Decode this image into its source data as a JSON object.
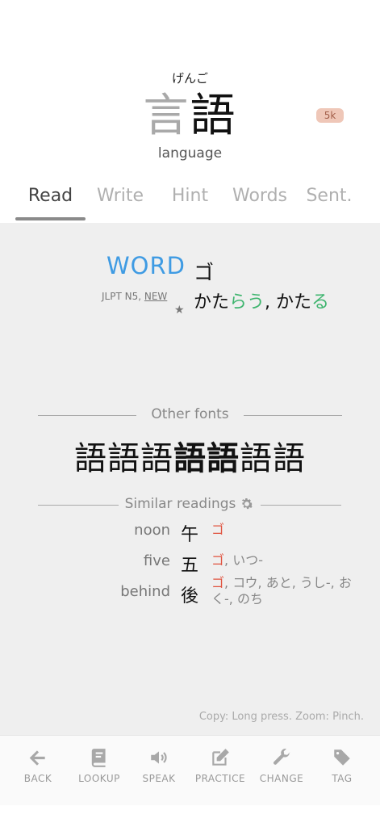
{
  "header": {
    "furigana": "げんご",
    "kanji_first": "言",
    "kanji_second": "語",
    "frequency_badge": "5k",
    "meaning": "language"
  },
  "tabs": [
    {
      "label": "Read",
      "active": true
    },
    {
      "label": "Write",
      "active": false
    },
    {
      "label": "Hint",
      "active": false
    },
    {
      "label": "Words",
      "active": false
    },
    {
      "label": "Sent.",
      "active": false
    }
  ],
  "reading": {
    "word_label": "WORD",
    "on_reading": "ゴ",
    "jlpt_prefix": "JLPT N5, ",
    "jlpt_new": "NEW",
    "star": "★",
    "kun_1_stem": "かた",
    "kun_1_okurigana": "らう",
    "kun_sep": ", ",
    "kun_2_stem": "かた",
    "kun_2_okurigana": "る"
  },
  "other_fonts": {
    "title": "Other fonts",
    "glyphs": [
      "語",
      "語",
      "語",
      "語",
      "語",
      "語",
      "語"
    ]
  },
  "similar_readings": {
    "title": "Similar readings",
    "items": [
      {
        "meaning": "noon",
        "kanji": "午",
        "match": "ゴ",
        "rest": ""
      },
      {
        "meaning": "five",
        "kanji": "五",
        "match": "ゴ",
        "rest": ", いつ-"
      },
      {
        "meaning": "behind",
        "kanji": "後",
        "match": "ゴ",
        "rest": ", コウ, あと, うし-, おく-, のち"
      }
    ]
  },
  "hint": "Copy: Long press. Zoom: Pinch.",
  "toolbar": {
    "back": "BACK",
    "lookup": "LOOKUP",
    "speak": "SPEAK",
    "practice": "PRACTICE",
    "change": "CHANGE",
    "tag": "TAG"
  },
  "colors": {
    "accent_blue": "#3f9be3",
    "okurigana_green": "#3fb56f",
    "match_red": "#e0533f",
    "badge_bg": "#efc7b8"
  }
}
